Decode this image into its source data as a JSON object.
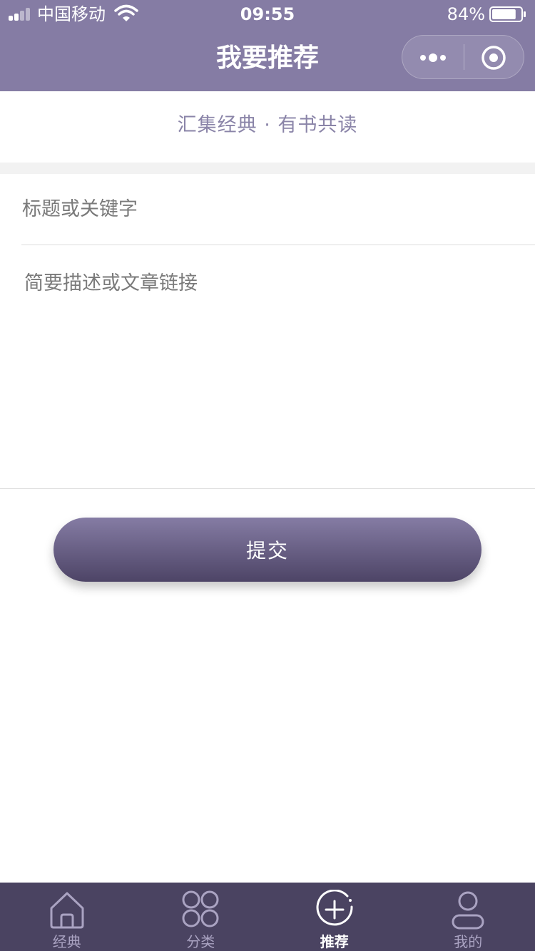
{
  "status_bar": {
    "carrier": "中国移动",
    "time": "09:55",
    "battery": "84%",
    "battery_level": 0.84
  },
  "nav": {
    "title": "我要推荐"
  },
  "slogan": "汇集经典 · 有书共读",
  "form": {
    "title_value": "",
    "title_placeholder": "标题或关键字",
    "desc_value": "",
    "desc_placeholder": "简要描述或文章链接",
    "submit_label": "提交"
  },
  "tabbar": {
    "items": [
      {
        "label": "经典",
        "icon": "home-icon",
        "active": false
      },
      {
        "label": "分类",
        "icon": "grid-icon",
        "active": false
      },
      {
        "label": "推荐",
        "icon": "plus-circle-icon",
        "active": true
      },
      {
        "label": "我的",
        "icon": "user-icon",
        "active": false
      }
    ]
  },
  "colors": {
    "header": "#857ca4",
    "tabbar": "#4a4361",
    "slogan": "#8a84a8",
    "button_top": "#857ca4",
    "button_bottom": "#4d4466"
  }
}
